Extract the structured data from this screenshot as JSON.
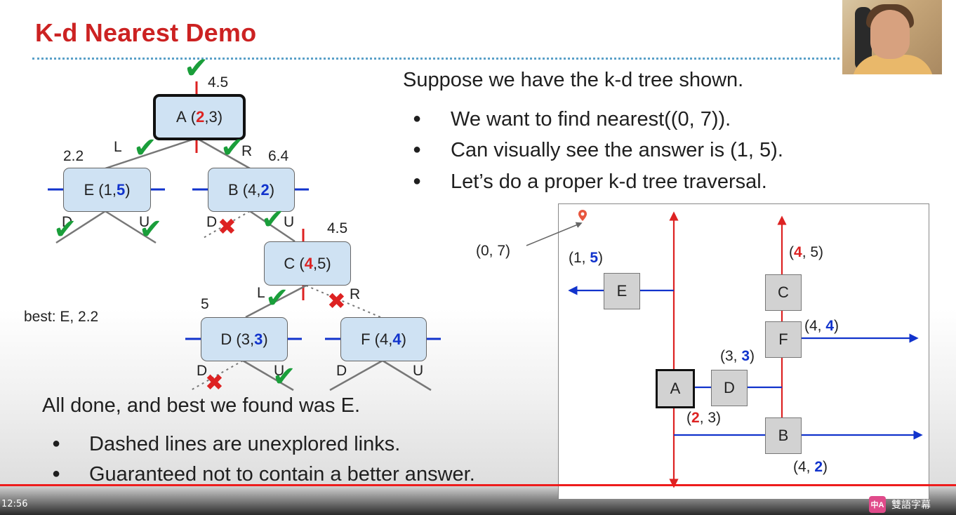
{
  "slide": {
    "title": "K-d Nearest Demo",
    "intro": "Suppose we have the k-d tree shown.",
    "bullets": [
      "We want to find nearest((0, 7)).",
      "Can visually see the answer is (1, 5).",
      "Let’s do a proper k-d tree traversal."
    ],
    "conclusion": "All done, and best we found was E.",
    "conclusion_bullets": [
      "Dashed lines are unexplored links.",
      "Guaranteed not to contain a better answer."
    ],
    "best_label": "best: E, 2.2",
    "bullet_glyph": "●"
  },
  "tree": {
    "nodes": {
      "A": {
        "name": "A",
        "x": "2",
        "y": "3",
        "dist": "4.5"
      },
      "E": {
        "name": "E",
        "x": "1",
        "y": "5",
        "dist": "2.2"
      },
      "B": {
        "name": "B",
        "x": "4",
        "y": "2",
        "dist": "6.4"
      },
      "C": {
        "name": "C",
        "x": "4",
        "y": "5",
        "dist": "4.5"
      },
      "D": {
        "name": "D",
        "x": "3",
        "y": "3",
        "dist": "5"
      },
      "F": {
        "name": "F",
        "x": "4",
        "y": "4"
      }
    },
    "edge_labels": {
      "L": "L",
      "R": "R",
      "D": "D",
      "U": "U"
    },
    "marks": {
      "check": "✔",
      "cross": "✖"
    },
    "open": "(",
    "close": ")",
    "comma": ", "
  },
  "panel": {
    "query": "(0, 7)",
    "labels": {
      "E": [
        "(1, ",
        "5",
        ")"
      ],
      "C": [
        "(",
        "4",
        ", 5)"
      ],
      "F": [
        "(4, ",
        "4",
        ")"
      ],
      "D": [
        "(3, ",
        "3",
        ")"
      ],
      "A": [
        "(",
        "2",
        ", 3)"
      ],
      "B": [
        "(4, ",
        "2",
        ")"
      ]
    },
    "squares": {
      "E": "E",
      "C": "C",
      "F": "F",
      "A": "A",
      "D": "D",
      "B": "B"
    }
  },
  "player": {
    "time": "12:56",
    "subtitle_label": "雙語字幕",
    "subtitle_logo": "中A"
  },
  "colors": {
    "title": "#cc2222",
    "split_x": "#dd2222",
    "split_y": "#1133cc",
    "check": "#1a9e3a",
    "cross": "#dd2222"
  }
}
